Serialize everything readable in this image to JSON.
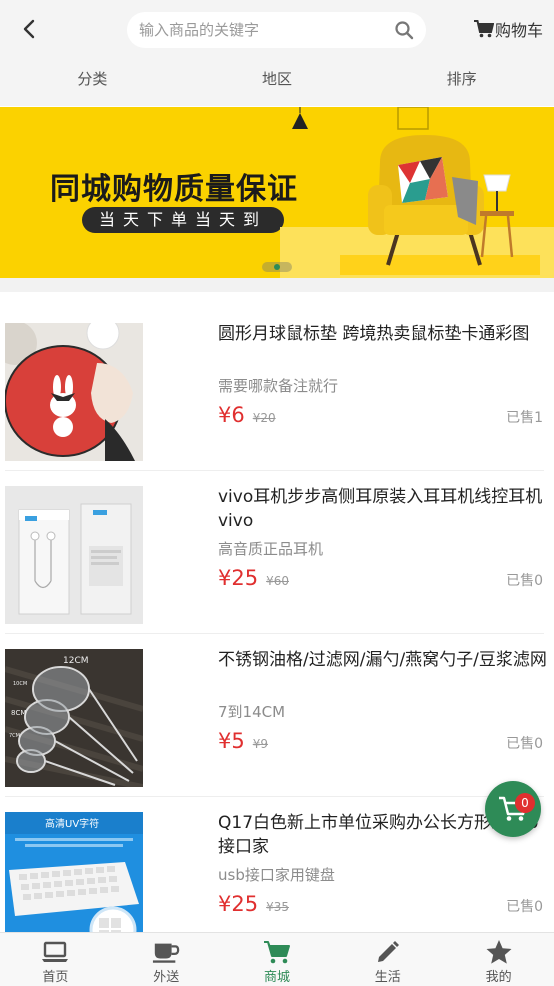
{
  "header": {
    "search_placeholder": "输入商品的关键字",
    "cart_label": "购物车"
  },
  "filters": [
    "分类",
    "地区",
    "排序"
  ],
  "banner": {
    "title": "同城购物质量保证",
    "subtitle": "当天下单当天到",
    "active_dot": 1
  },
  "products": [
    {
      "name": "圆形月球鼠标垫 跨境热卖鼠标垫卡通彩图",
      "desc": "需要哪款备注就行",
      "price": "¥6",
      "old_price": "¥20",
      "sold": "已售1",
      "icon": "mousepad-image"
    },
    {
      "name": "vivo耳机步步高侧耳原装入耳耳机线控耳机vivo",
      "desc": "高音质正品耳机",
      "price": "¥25",
      "old_price": "¥60",
      "sold": "已售0",
      "icon": "earphones-image"
    },
    {
      "name": "不锈钢油格/过滤网/漏勺/燕窝勺子/豆浆滤网",
      "desc": "7到14CM",
      "price": "¥5",
      "old_price": "¥9",
      "sold": "已售0",
      "icon": "strainer-image",
      "image_text": [
        "12CM",
        "10CM",
        "8CM",
        "7CM"
      ]
    },
    {
      "name": "Q17白色新上市单位采购办公长方形线usb接口家",
      "desc": "usb接口家用键盘",
      "price": "¥25",
      "old_price": "¥35",
      "sold": "已售0",
      "icon": "keyboard-image",
      "image_text": [
        "高清UV字符"
      ]
    }
  ],
  "float_cart": {
    "count": "0"
  },
  "tabbar": [
    {
      "label": "首页",
      "icon": "laptop-icon",
      "active": false
    },
    {
      "label": "外送",
      "icon": "coffee-icon",
      "active": false
    },
    {
      "label": "商城",
      "icon": "cart-icon",
      "active": true
    },
    {
      "label": "生活",
      "icon": "pencil-icon",
      "active": false
    },
    {
      "label": "我的",
      "icon": "star-icon",
      "active": false
    }
  ],
  "colors": {
    "accent": "#2e8b57",
    "price": "#e02f2f",
    "banner": "#fbd200"
  }
}
